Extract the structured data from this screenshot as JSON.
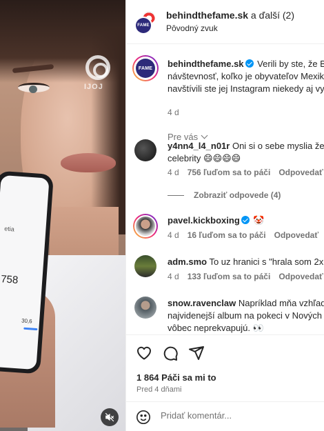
{
  "media": {
    "watermark_text": "IJOJ",
    "phone_label": "etia",
    "phone_value": "758",
    "phone_small": "30,6"
  },
  "header": {
    "username": "behindthefame.sk",
    "rest": " a ďalší (2)",
    "audio": "Pôvodný zvuk",
    "avatar_text": "FAME"
  },
  "caption": {
    "username": "behindthefame.sk",
    "line1": " Verili by ste, že B",
    "line2": "návštevnosť, koľko je obyvateľov Mexik",
    "line3": "navštívili ste jej Instagram niekedy aj vy",
    "time": "4 d",
    "see_translation": "Pre vás"
  },
  "comments": [
    {
      "username": "y4nn4_l4_n01r",
      "line1": " Oni si o sebe myslia že",
      "line2": "celebrity 😄😄😄😄",
      "time": "4 d",
      "likes": "756 ľuďom sa to páči",
      "reply": "Odpovedať",
      "view_replies": "Zobraziť odpovede (4)"
    },
    {
      "username": "pavel.kickboxing",
      "line1": " 🤡",
      "time": "4 d",
      "likes": "16 ľuďom sa to páči",
      "reply": "Odpovedať"
    },
    {
      "username": "adm.smo",
      "line1": " To uz hranici s \"hrala som 2x",
      "time": "4 d",
      "likes": "133 ľuďom sa to páči",
      "reply": "Odpovedať"
    },
    {
      "username": "snow.ravenclaw",
      "line1": " Napríklad mňa vzhľade",
      "line2": "najvidenejší album na pokeci v Nových",
      "line3": "vôbec neprekvapujú. 👀"
    }
  ],
  "actions": {
    "likes": "1 864 Páči sa mi to",
    "date": "Pred 4 dňami",
    "comment_placeholder": "Pridať komentár..."
  },
  "icons": {
    "like": "heart-icon",
    "comment": "comment-icon",
    "share": "share-icon",
    "emoji": "emoji-icon",
    "mute": "muted-speaker-icon"
  },
  "colors": {
    "verified": "#0095f6",
    "muted_text": "#737373",
    "text": "#262626"
  }
}
